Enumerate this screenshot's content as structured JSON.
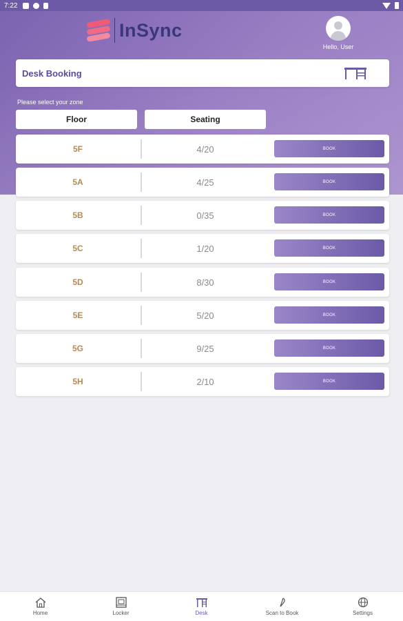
{
  "status_bar": {
    "time": "7:22"
  },
  "app": {
    "name": "InSync"
  },
  "user": {
    "greeting": "Hello, User"
  },
  "desk_bar": {
    "title": "Desk Booking"
  },
  "zone_prompt": "Please select your zone",
  "tabs": [
    {
      "label": "Floor"
    },
    {
      "label": "Seating"
    }
  ],
  "rows": [
    {
      "floor": "5F",
      "seats": "4/20",
      "action": "BOOK"
    },
    {
      "floor": "5A",
      "seats": "4/25",
      "action": "BOOK"
    },
    {
      "floor": "5B",
      "seats": "0/35",
      "action": "BOOK"
    },
    {
      "floor": "5C",
      "seats": "1/20",
      "action": "BOOK"
    },
    {
      "floor": "5D",
      "seats": "8/30",
      "action": "BOOK"
    },
    {
      "floor": "5E",
      "seats": "5/20",
      "action": "BOOK"
    },
    {
      "floor": "5G",
      "seats": "9/25",
      "action": "BOOK"
    },
    {
      "floor": "5H",
      "seats": "2/10",
      "action": "BOOK"
    }
  ],
  "bottom_nav": [
    {
      "label": "Home",
      "icon": "home-icon"
    },
    {
      "label": "Locker",
      "icon": "locker-icon"
    },
    {
      "label": "Desk",
      "icon": "desk-icon",
      "active": true
    },
    {
      "label": "Scan to Book",
      "icon": "scan-icon"
    },
    {
      "label": "Settings",
      "icon": "globe-icon"
    }
  ],
  "colors": {
    "accent": "#6b5aa8",
    "floor_text": "#b48a55",
    "logo_pink": "#ef5b77",
    "logo_text": "#3a3878"
  }
}
